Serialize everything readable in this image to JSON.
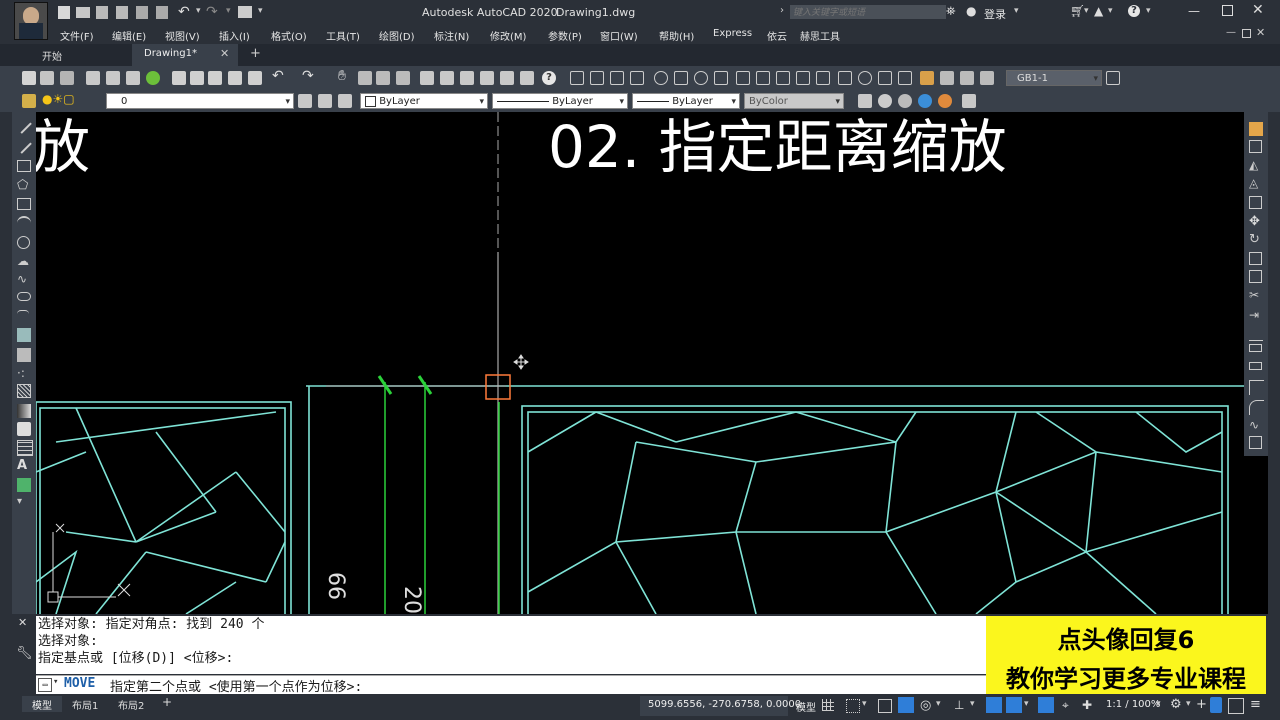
{
  "title": {
    "app": "Autodesk AutoCAD 2020",
    "file": "Drawing1.dwg"
  },
  "search": {
    "placeholder": "键入关键字或短语"
  },
  "user": {
    "login": "登录"
  },
  "menu": [
    "文件(F)",
    "编辑(E)",
    "视图(V)",
    "插入(I)",
    "格式(O)",
    "工具(T)",
    "绘图(D)",
    "标注(N)",
    "修改(M)",
    "参数(P)",
    "窗口(W)",
    "帮助(H)",
    "Express",
    "依云",
    "赫思工具"
  ],
  "tabs": {
    "start": "开始",
    "drawing": "Drawing1*",
    "new": "+"
  },
  "toolbar": {
    "dimstyle": "GB1-1"
  },
  "layers": {
    "current": "0",
    "color": "ByLayer",
    "linetype": "ByLayer",
    "lineweight": "ByLayer",
    "plotstyle": "ByColor"
  },
  "canvas": {
    "caption_left": "缩放",
    "caption_right": "02. 指定距离缩放",
    "dim_a": "66",
    "dim_b": "20"
  },
  "command": {
    "history": [
      "选择对象: 指定对角点: 找到 240 个",
      "选择对象:",
      "指定基点或 [位移(D)] <位移>:"
    ],
    "current_cmd": "MOVE",
    "current_prompt": "指定第二个点或 <使用第一个点作为位移>:"
  },
  "promo": {
    "line1": "点头像回复6",
    "line2": "教你学习更多专业课程"
  },
  "layout_tabs": [
    "模型",
    "布局1",
    "布局2",
    "+"
  ],
  "status": {
    "coords": "5099.6556, -270.6758, 0.0000",
    "mode": "模型",
    "scale": "1:1 / 100%"
  },
  "colors": {
    "bg": "#000000",
    "geometry": "#7fe3d6",
    "ui": "#2b3038",
    "promo": "#fbf61d"
  }
}
